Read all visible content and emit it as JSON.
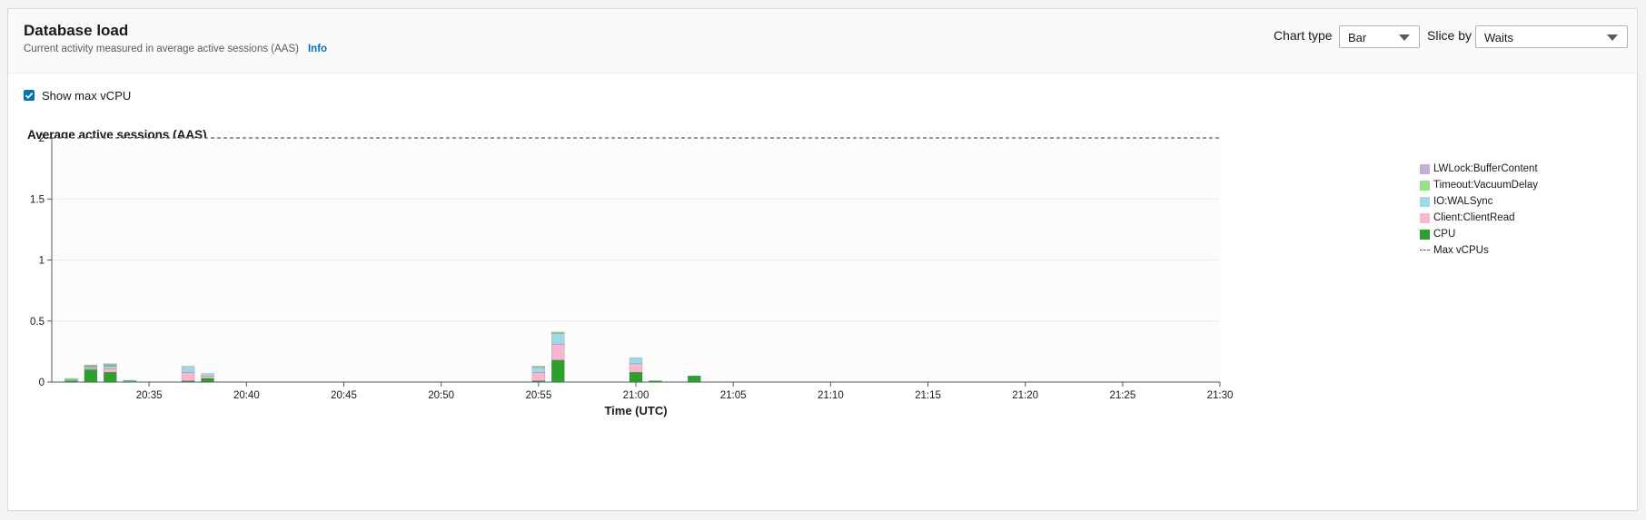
{
  "header": {
    "title": "Database load",
    "subtitle": "Current activity measured in average active sessions (AAS)",
    "info_link": "Info"
  },
  "controls": {
    "chart_type_label": "Chart type",
    "chart_type_value": "Bar",
    "slice_by_label": "Slice by",
    "slice_by_value": "Waits"
  },
  "options": {
    "show_max_vcpu_label": "Show max vCPU",
    "show_max_vcpu_checked": true
  },
  "chart_data": {
    "type": "bar",
    "stacked": true,
    "title": "Average active sessions (AAS)",
    "xlabel": "Time (UTC)",
    "ylabel": "",
    "ylim": [
      0,
      2
    ],
    "xlim": [
      "20:30",
      "21:30"
    ],
    "yticks": [
      "0",
      "0.5",
      "1",
      "1.5",
      "2"
    ],
    "xticks": [
      "20:35",
      "20:40",
      "20:45",
      "20:50",
      "20:55",
      "21:00",
      "21:05",
      "21:10",
      "21:15",
      "21:20",
      "21:25",
      "21:30"
    ],
    "grid": true,
    "legend_position": "right",
    "max_vcpu": 2,
    "categories": [
      "20:31",
      "20:32",
      "20:33",
      "20:34",
      "20:37",
      "20:38",
      "20:55",
      "20:56",
      "21:00",
      "21:01",
      "21:03"
    ],
    "series": [
      {
        "name": "CPU",
        "color": "#2ca02c",
        "values": [
          0.01,
          0.1,
          0.08,
          0.005,
          0.01,
          0.03,
          0.01,
          0.18,
          0.08,
          0.01,
          0.05
        ]
      },
      {
        "name": "Client:ClientRead",
        "color": "#f7b6d2",
        "values": [
          0,
          0.01,
          0.03,
          0,
          0.07,
          0.02,
          0.07,
          0.13,
          0.07,
          0,
          0
        ]
      },
      {
        "name": "IO:WALSync",
        "color": "#9edae5",
        "values": [
          0.01,
          0.01,
          0.02,
          0.005,
          0.05,
          0.02,
          0.04,
          0.09,
          0.05,
          0,
          0
        ]
      },
      {
        "name": "Timeout:VacuumDelay",
        "color": "#98df8a",
        "values": [
          0.01,
          0.01,
          0.01,
          0.005,
          0,
          0,
          0.01,
          0.01,
          0,
          0,
          0
        ]
      },
      {
        "name": "LWLock:BufferContent",
        "color": "#c5b0d5",
        "values": [
          0,
          0.01,
          0.01,
          0,
          0,
          0,
          0,
          0,
          0,
          0,
          0
        ]
      }
    ],
    "max_line_label": "Max vCPUs"
  },
  "colors": {
    "accent": "#0073bb",
    "max_line": "#545b64",
    "grid": "#eaeded"
  }
}
